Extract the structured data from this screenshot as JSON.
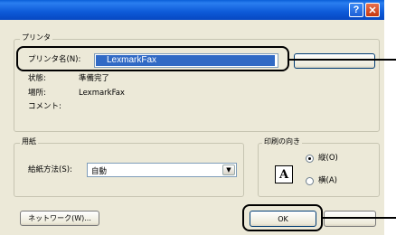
{
  "printer_group": {
    "legend": "プリンタ",
    "name_label": "プリンタ名(N):",
    "name_value": "LexmarkFax",
    "status_label": "状態:",
    "status_value": "準備完了",
    "location_label": "場所:",
    "location_value": "LexmarkFax",
    "comment_label": "コメント:"
  },
  "paper_group": {
    "legend": "用紙",
    "source_label": "給紙方法(S):",
    "source_value": "自動"
  },
  "orientation_group": {
    "legend": "印刷の向き",
    "portrait_label": "縦(O)",
    "landscape_label": "横(A)",
    "icon_letter": "A"
  },
  "buttons": {
    "network": "ネットワーク(W)...",
    "ok": "OK"
  },
  "titlebar": {
    "help": "?",
    "close": "✕"
  }
}
